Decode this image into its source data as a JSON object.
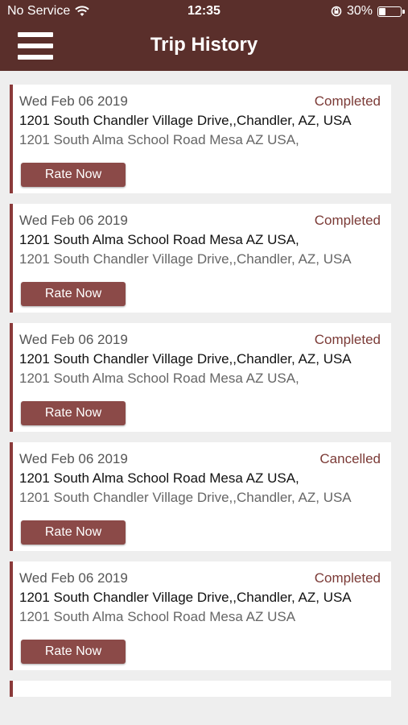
{
  "status_bar": {
    "carrier": "No Service",
    "time": "12:35",
    "battery": "30%",
    "battery_level": 0.3
  },
  "header": {
    "title": "Trip History",
    "menu_icon": "hamburger-menu-icon"
  },
  "colors": {
    "header_bg": "#5a2f2b",
    "accent": "#8b3a3a",
    "button_bg": "#8b4a48",
    "status_text": "#7b3a36"
  },
  "trips": [
    {
      "date": "Wed Feb 06 2019",
      "status": "Completed",
      "pickup": "1201 South Chandler Village Drive,,Chandler, AZ, USA",
      "drop": "1201 South Alma School Road Mesa AZ USA,",
      "action": "Rate Now"
    },
    {
      "date": "Wed Feb 06 2019",
      "status": "Completed",
      "pickup": "1201 South Alma School Road Mesa AZ USA,",
      "drop": "1201 South Chandler Village Drive,,Chandler, AZ, USA",
      "action": "Rate Now"
    },
    {
      "date": "Wed Feb 06 2019",
      "status": "Completed",
      "pickup": "1201 South Chandler Village Drive,,Chandler, AZ, USA",
      "drop": "1201 South Alma School Road Mesa AZ USA,",
      "action": "Rate Now"
    },
    {
      "date": "Wed Feb 06 2019",
      "status": "Cancelled",
      "pickup": "1201 South Alma School Road Mesa AZ USA,",
      "drop": "1201 South Chandler Village Drive,,Chandler, AZ, USA",
      "action": "Rate Now"
    },
    {
      "date": "Wed Feb 06 2019",
      "status": "Completed",
      "pickup": "1201 South Chandler Village Drive,,Chandler, AZ, USA",
      "drop": "1201 South Alma School Road Mesa AZ USA",
      "action": "Rate Now"
    }
  ]
}
